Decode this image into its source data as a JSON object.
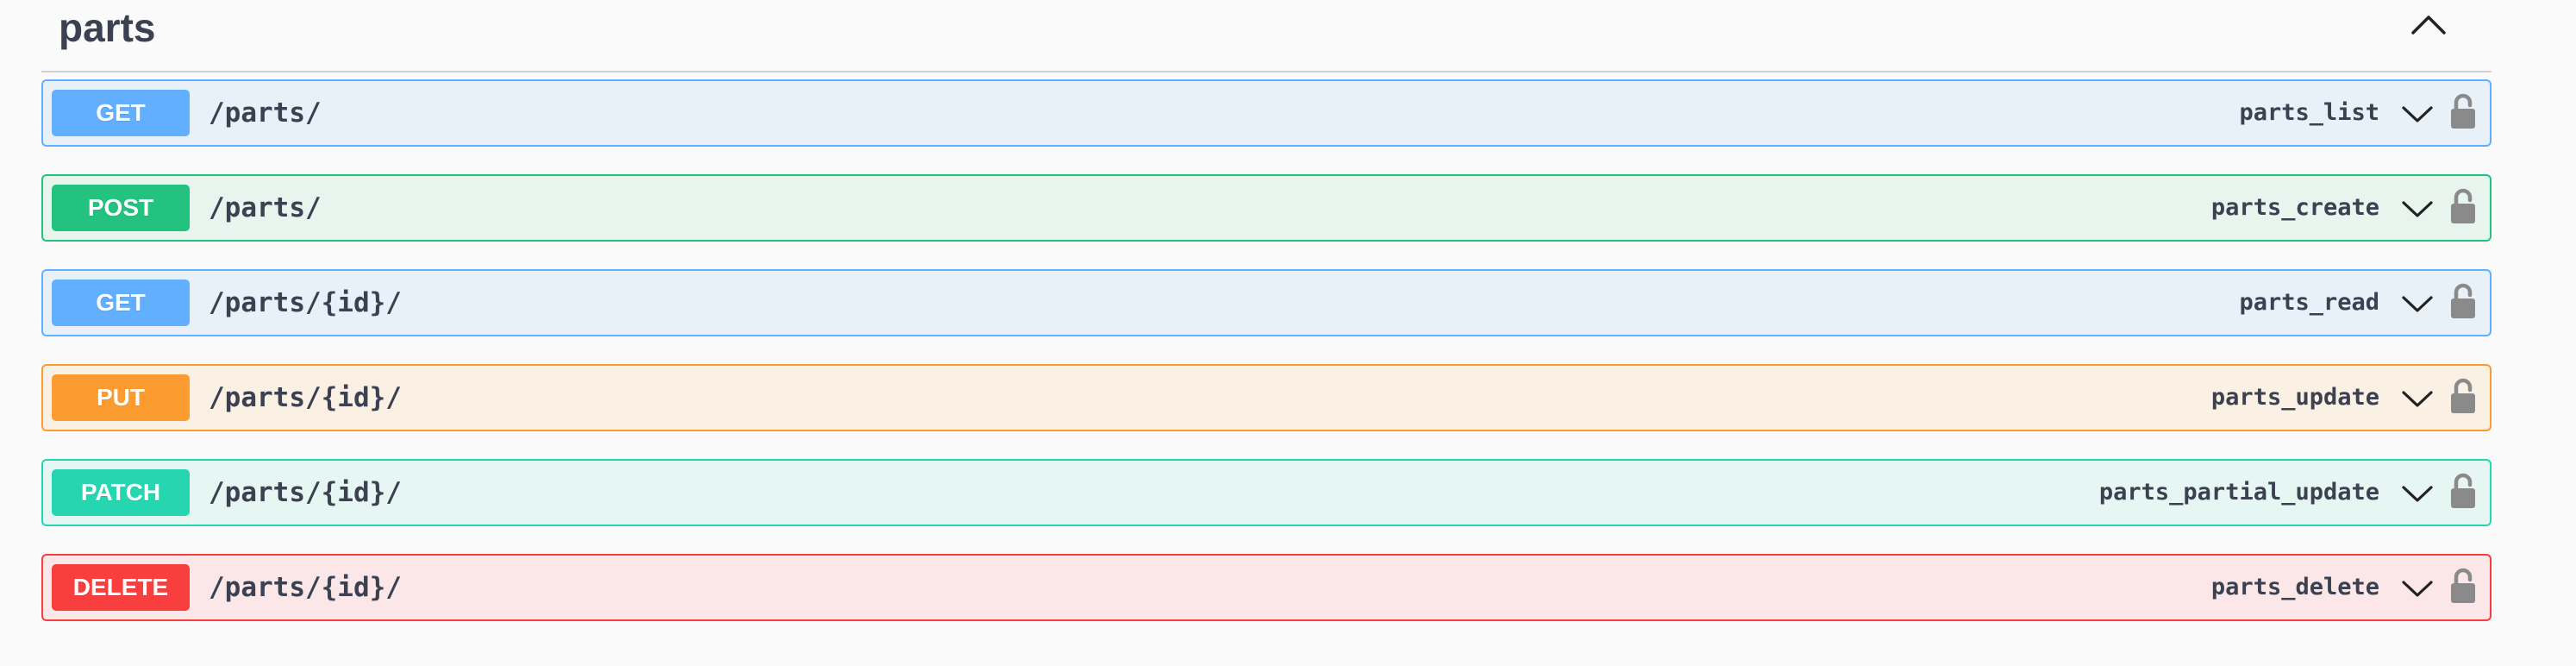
{
  "section": {
    "title": "parts",
    "collapse_icon": "chevron-up-icon"
  },
  "operations": [
    {
      "method": "GET",
      "path": "/parts/",
      "operation_id": "parts_list",
      "color": "#61affe",
      "bg": "#e8f0f8"
    },
    {
      "method": "POST",
      "path": "/parts/",
      "operation_id": "parts_create",
      "color": "#23c27e",
      "bg": "#e7f5ee"
    },
    {
      "method": "GET",
      "path": "/parts/{id}/",
      "operation_id": "parts_read",
      "color": "#61affe",
      "bg": "#e8f0f8"
    },
    {
      "method": "PUT",
      "path": "/parts/{id}/",
      "operation_id": "parts_update",
      "color": "#fc9b30",
      "bg": "#fbf0e4"
    },
    {
      "method": "PATCH",
      "path": "/parts/{id}/",
      "operation_id": "parts_partial_update",
      "color": "#25d6b0",
      "bg": "#e6f7f3"
    },
    {
      "method": "DELETE",
      "path": "/parts/{id}/",
      "operation_id": "parts_delete",
      "color": "#f93e3e",
      "bg": "#fbe7e7"
    }
  ],
  "icons": {
    "expand": "chevron-down-icon",
    "auth": "unlocked-padlock-icon"
  }
}
